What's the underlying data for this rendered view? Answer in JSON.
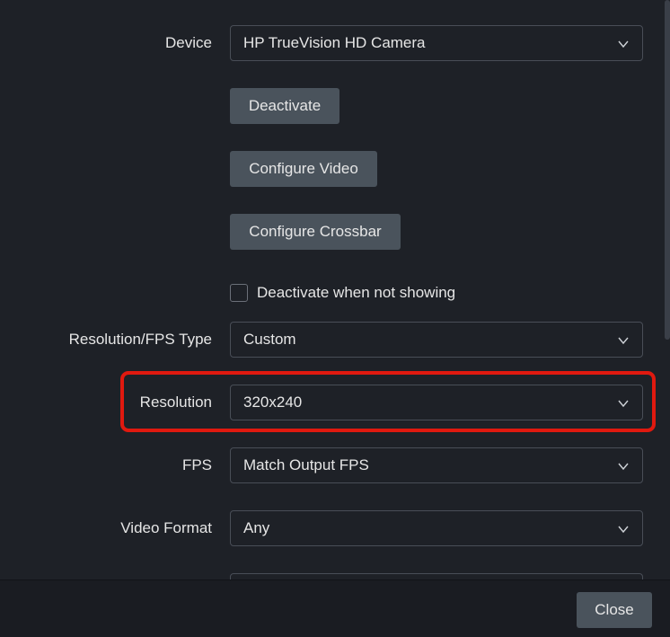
{
  "form": {
    "device": {
      "label": "Device",
      "value": "HP TrueVision HD Camera"
    },
    "deactivate_button": "Deactivate",
    "configure_video_button": "Configure Video",
    "configure_crossbar_button": "Configure Crossbar",
    "deactivate_when_not_showing": {
      "label": "Deactivate when not showing",
      "checked": false
    },
    "resolution_fps_type": {
      "label": "Resolution/FPS Type",
      "value": "Custom"
    },
    "resolution": {
      "label": "Resolution",
      "value": "320x240"
    },
    "fps": {
      "label": "FPS",
      "value": "Match Output FPS"
    },
    "video_format": {
      "label": "Video Format",
      "value": "Any"
    }
  },
  "footer": {
    "close_label": "Close"
  },
  "colors": {
    "highlight": "#e0190f",
    "background": "#1e2127",
    "button": "#4a535c"
  },
  "icons": {
    "dropdown": "chevron-down-icon"
  }
}
